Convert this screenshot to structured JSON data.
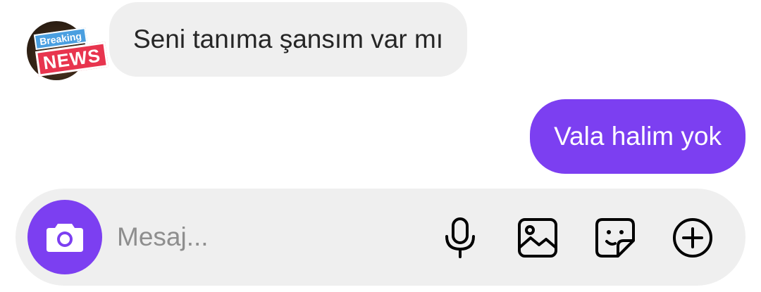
{
  "contact": {
    "avatar_badge_top": "Breaking",
    "avatar_badge_main": "NEWS"
  },
  "messages": [
    {
      "direction": "incoming",
      "text": "Seni tanıma şansım var mı"
    },
    {
      "direction": "outgoing",
      "text": "Vala halim yok"
    }
  ],
  "composer": {
    "placeholder": "Mesaj...",
    "value": "",
    "icons": [
      "camera-icon",
      "microphone-icon",
      "gallery-icon",
      "sticker-icon",
      "plus-icon"
    ]
  },
  "colors": {
    "accent": "#7c3ff1",
    "incoming_bubble": "#efefef",
    "composer_bg": "#efefef",
    "text_dark": "#262626",
    "placeholder": "#8e8e8e"
  }
}
